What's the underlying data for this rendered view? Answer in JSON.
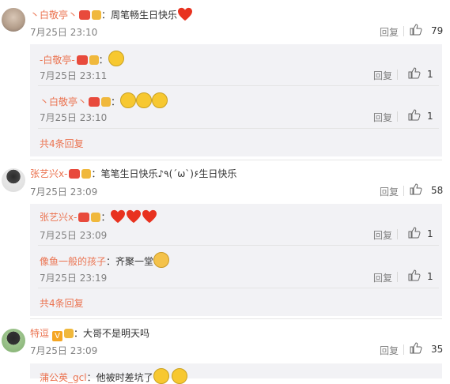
{
  "reply_label": "回复",
  "comments": [
    {
      "user": "丶白敬亭丶",
      "text": "：周笔畅生日快乐",
      "time": "7月25日 23:10",
      "likes": "79",
      "replies": [
        {
          "user": "-白敬亭-",
          "text": "：",
          "time": "7月25日 23:11",
          "likes": "1"
        },
        {
          "user": "丶白敬亭丶",
          "text": "：",
          "time": "7月25日 23:10",
          "likes": "1"
        }
      ],
      "more": "共4条回复"
    },
    {
      "user": "张艺兴x-",
      "text": "：笔笔生日快乐♪٩(´ω`)۶生日快乐",
      "time": "7月25日 23:09",
      "likes": "58",
      "replies": [
        {
          "user": "张艺兴x-",
          "text": "：",
          "time": "7月25日 23:09",
          "likes": "1"
        },
        {
          "user": "像鱼一般的孩子",
          "text": "：齐聚一堂",
          "time": "7月25日 23:19",
          "likes": "1"
        }
      ],
      "more": "共4条回复"
    },
    {
      "user": "特逗",
      "text": "：大哥不是明天吗",
      "time": "7月25日 23:09",
      "likes": "35",
      "replies": [
        {
          "user": "蒲公英_gcl",
          "text": "：他被时差坑了"
        }
      ]
    }
  ],
  "colors": {
    "name": "#eb7350",
    "sub_bg": "#f2f2f5",
    "vip_badge": "#f5a623"
  }
}
